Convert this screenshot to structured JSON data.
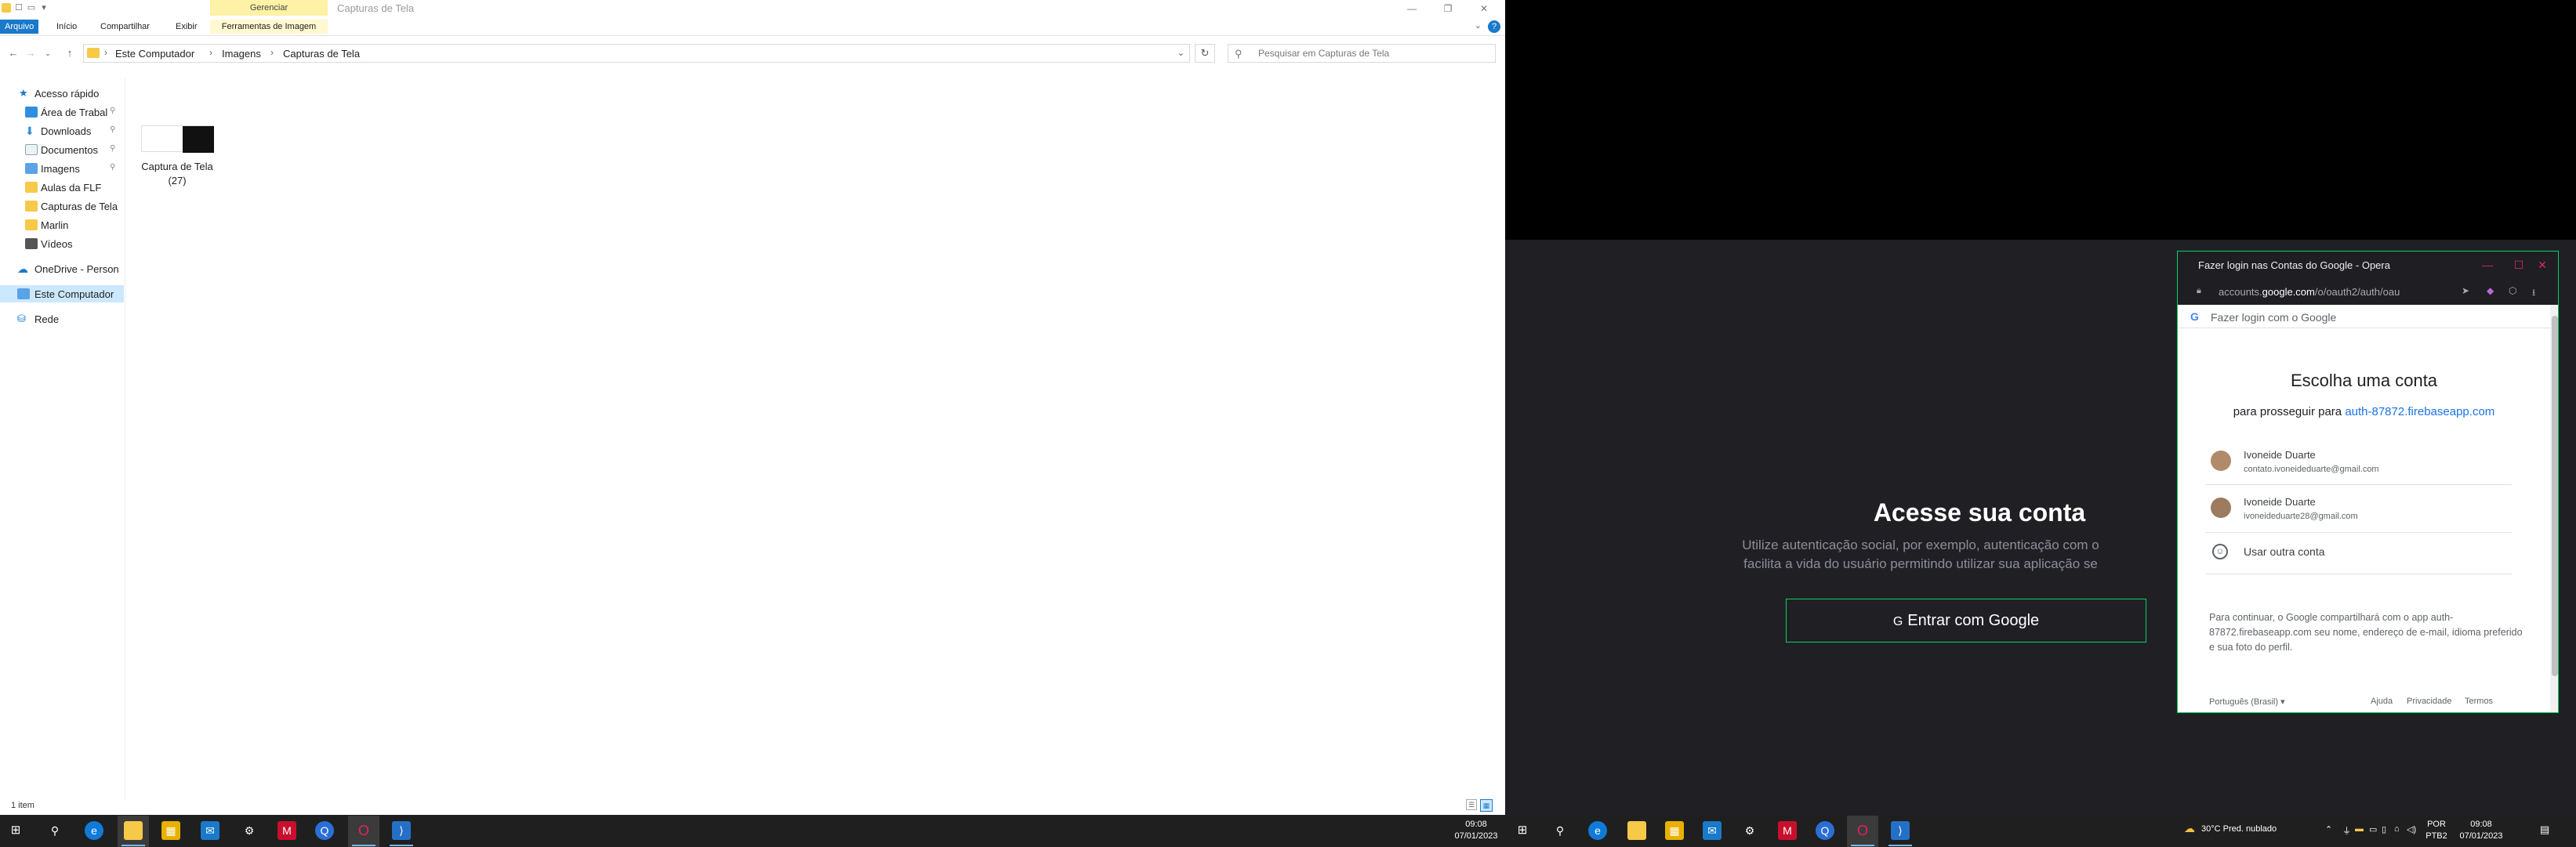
{
  "explorer": {
    "window_title": "Capturas de Tela",
    "manage_tab": "Gerenciar",
    "ribbon_tabs": {
      "file": "Arquivo",
      "home": "Início",
      "share": "Compartilhar",
      "view": "Exibir",
      "tools": "Ferramentas de Imagem"
    },
    "help_label": "?",
    "breadcrumb": [
      "Este Computador",
      "Imagens",
      "Capturas de Tela"
    ],
    "search_placeholder": "Pesquisar em Capturas de Tela",
    "nav": {
      "quick_access": "Acesso rápido",
      "desktop": "Área de Trabal",
      "downloads": "Downloads",
      "documents": "Documentos",
      "pictures": "Imagens",
      "aulas": "Aulas da FLF",
      "capturas": "Capturas de Tela",
      "marlin": "Marlin",
      "videos": "Vídeos",
      "onedrive": "OneDrive - Person",
      "this_pc": "Este Computador",
      "network": "Rede"
    },
    "file": {
      "label": "Captura de Tela (27)"
    },
    "status_count": "1 item"
  },
  "web": {
    "heading": "Acesse sua conta",
    "description": "Utilize autenticação social, por exemplo, autenticação com o facilita a vida do usuário permitindo utilizar sua aplicação se",
    "google_button": "Entrar com Google",
    "accent": "#04d361",
    "background": "#202024"
  },
  "popup": {
    "title": "Fazer login nas Contas do Google - Opera",
    "url_prefix": "accounts.",
    "url_domain": "google.com",
    "url_path": "/o/oauth2/auth/oau",
    "header_text": "Fazer login com o Google",
    "choose_title": "Escolha uma conta",
    "continue_text": "para prosseguir para",
    "continue_link": "auth-87872.firebaseapp.com",
    "accounts": [
      {
        "name": "Ivoneide Duarte",
        "email": "contato.ivoneideduarte@gmail.com"
      },
      {
        "name": "Ivoneide Duarte",
        "email": "ivoneideduarte28@gmail.com"
      }
    ],
    "other_account": "Usar outra conta",
    "consent": "Para continuar, o Google compartilhará com o app auth-87872.firebaseapp.com seu nome, endereço de e-mail, idioma preferido e sua foto do perfil.",
    "footer": {
      "language": "Português (Brasil)",
      "help": "Ajuda",
      "privacy": "Privacidade",
      "terms": "Termos"
    }
  },
  "taskbar_left": {
    "time": "09:08",
    "date": "07/01/2023"
  },
  "taskbar_right": {
    "weather": "30°C  Pred. nublado",
    "lang_top": "POR",
    "lang_bottom": "PTB2",
    "time": "09:08",
    "date": "07/01/2023"
  }
}
